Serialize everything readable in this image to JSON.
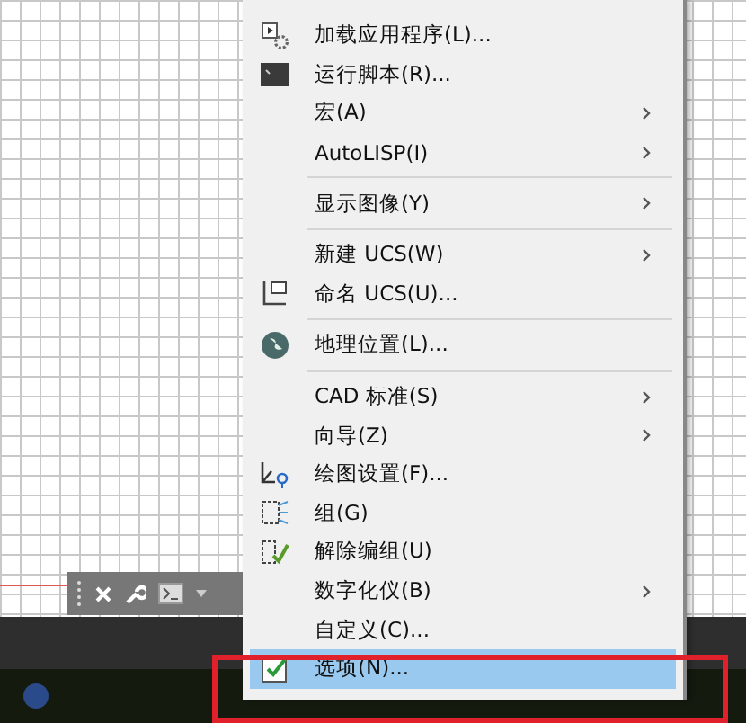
{
  "context_menu": {
    "items": [
      {
        "kind": "item",
        "label": "加载应用程序(L)...",
        "submenu": false,
        "selected": false
      },
      {
        "kind": "item",
        "label": "运行脚本(R)...",
        "submenu": false,
        "selected": false
      },
      {
        "kind": "item",
        "label": "宏(A)",
        "submenu": true,
        "selected": false
      },
      {
        "kind": "item",
        "label": "AutoLISP(I)",
        "submenu": true,
        "selected": false
      },
      {
        "kind": "separator"
      },
      {
        "kind": "item",
        "label": "显示图像(Y)",
        "submenu": true,
        "selected": false
      },
      {
        "kind": "separator"
      },
      {
        "kind": "item",
        "label": "新建 UCS(W)",
        "submenu": true,
        "selected": false
      },
      {
        "kind": "item",
        "label": "命名 UCS(U)...",
        "submenu": false,
        "selected": false
      },
      {
        "kind": "separator"
      },
      {
        "kind": "item",
        "label": "地理位置(L)...",
        "submenu": false,
        "selected": false
      },
      {
        "kind": "separator"
      },
      {
        "kind": "item",
        "label": "CAD 标准(S)",
        "submenu": true,
        "selected": false
      },
      {
        "kind": "item",
        "label": "向导(Z)",
        "submenu": true,
        "selected": false
      },
      {
        "kind": "item",
        "label": "绘图设置(F)...",
        "submenu": false,
        "selected": false
      },
      {
        "kind": "item",
        "label": "组(G)",
        "submenu": false,
        "selected": false
      },
      {
        "kind": "item",
        "label": "解除编组(U)",
        "submenu": false,
        "selected": false
      },
      {
        "kind": "item",
        "label": "数字化仪(B)",
        "submenu": true,
        "selected": false
      },
      {
        "kind": "item",
        "label": "自定义(C)...",
        "submenu": false,
        "selected": false
      },
      {
        "kind": "item",
        "label": "选项(N)...",
        "submenu": false,
        "selected": true
      }
    ]
  }
}
